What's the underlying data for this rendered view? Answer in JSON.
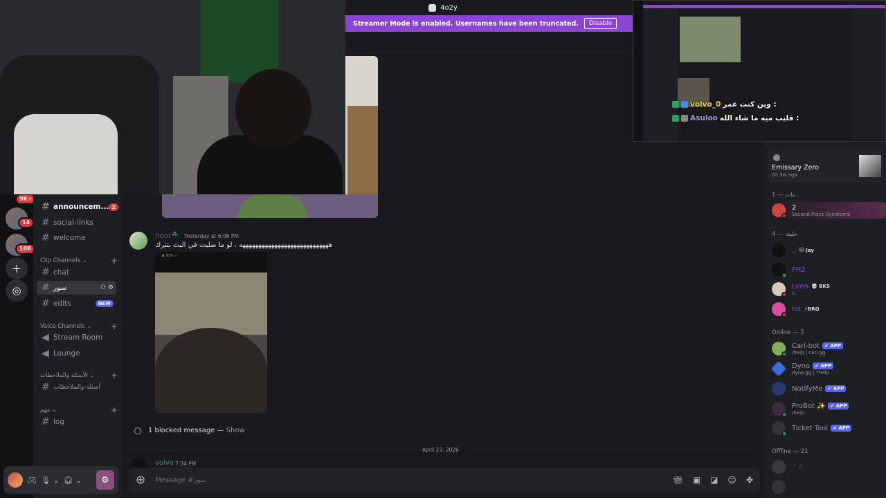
{
  "topbar": {
    "title": "4o2y"
  },
  "streamer_banner": {
    "text": "Streamer Mode is enabled. Usernames have been truncated.",
    "button": "Disable"
  },
  "server_rail": {
    "badges": [
      "9K+",
      "14",
      "108"
    ],
    "add_icon": "plus-icon",
    "discover_icon": "compass-icon"
  },
  "channels": {
    "announcements": {
      "label": "announcem...",
      "mention": "2"
    },
    "social_links": "social-links",
    "welcome": "welcome",
    "clip_category": "Clip Channels",
    "chat": "chat",
    "sowar": "سور",
    "edits": "edits",
    "edits_badge": "NEW",
    "voice_category": "Voice Channels",
    "stream_room": "Stream Room",
    "lounge": "Lounge",
    "feedback_category": "الأسئلة والملاحظات",
    "feedback_channel": "أسئلة-والملاحظات",
    "important_category": "مهم",
    "log": "log"
  },
  "messages": [
    {
      "author": "noor",
      "timestamp": "Yesterday at 6:06 PM",
      "text": "ههههههههههههههههههههههههههههه ، لو ما ضليت في البث بتترك"
    }
  ],
  "blocked": {
    "text": "1 blocked message — ",
    "show": "Show"
  },
  "date_separator": "April 23, 2026",
  "last_message": {
    "author": "volvo",
    "timestamp": "7:34 PM"
  },
  "composer": {
    "placeholder": "Message #سور"
  },
  "members": {
    "activity": {
      "name": "Emissary Zero",
      "sub": "3w ago"
    },
    "cat_girls": "بنات — 1",
    "second_place": {
      "name": "2",
      "sub": "Second Place Syndrome"
    },
    "cat_special": "حليته — 4",
    "jay": {
      "name": "..",
      "tag": "Jay"
    },
    "fh2": "FH2",
    "leen": {
      "name": "Leen",
      "tag": "BKS"
    },
    "tot": {
      "name": "tot",
      "tag": "BRQ"
    },
    "cat_online": "Online — 5",
    "carl": {
      "name": "Carl-bot",
      "tag": "APP",
      "sub": "/help | carl.gg"
    },
    "dyno": {
      "name": "Dyno",
      "tag": "APP",
      "sub": "dyno.gg | ?help"
    },
    "notify": {
      "name": "NotifyMe",
      "tag": "APP"
    },
    "probot": {
      "name": "ProBot ✨",
      "tag": "APP",
      "sub": "/help"
    },
    "ticket": {
      "name": "Ticket Tool",
      "tag": "APP"
    },
    "cat_offline": "Offline — 21",
    "off1": "? #"
  },
  "mini_window": {
    "line1_name": "volvo_0",
    "line1_text": "وين كنت عمر :",
    "line2_name": "Asuloo",
    "line2_text": "قليب ميه ما شاء الله :"
  },
  "colors": {
    "accent": "#5865f2",
    "streamer": "#8c44d6",
    "mention": "#da373c",
    "online": "#23a55a"
  }
}
